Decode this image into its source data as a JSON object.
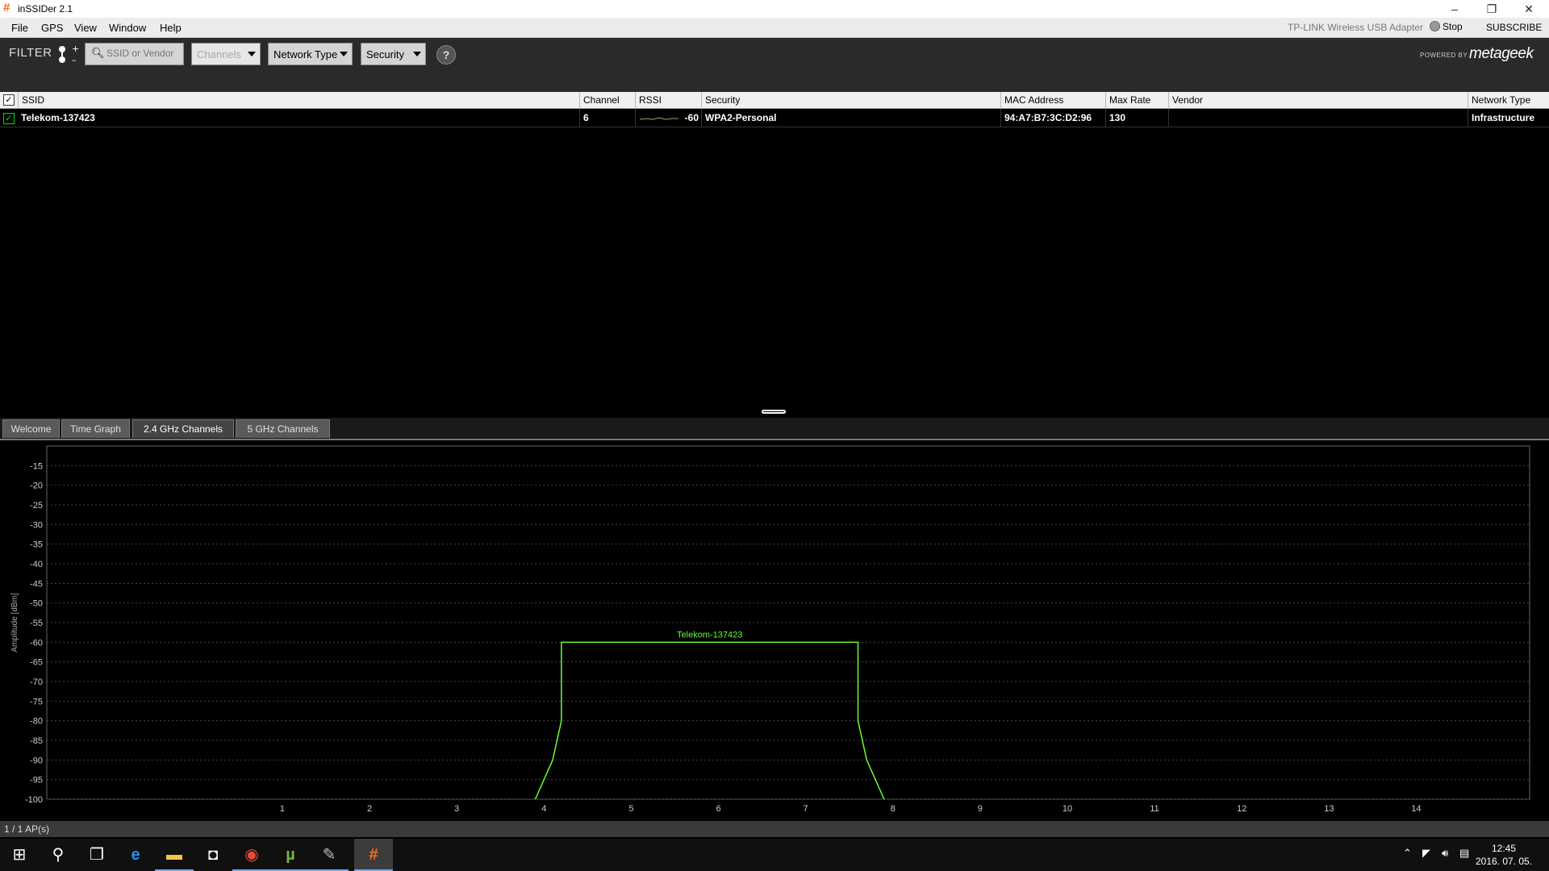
{
  "window": {
    "title": "inSSIDer 2.1",
    "icon": "hash-icon",
    "minimize": "–",
    "restore": "❐",
    "close": "✕"
  },
  "menu": {
    "items": [
      "File",
      "GPS",
      "View",
      "Window",
      "Help"
    ],
    "adapter": "TP-LINK Wireless USB Adapter",
    "stop_label": "Stop",
    "subscribe_label": "SUBSCRIBE"
  },
  "filter": {
    "label": "FILTER",
    "search_placeholder": "SSID or Vendor",
    "channels_label": "Channels",
    "network_type_label": "Network Type",
    "security_label": "Security",
    "help_label": "?",
    "powered_by": "POWERED BY",
    "brand": "metageek"
  },
  "table": {
    "columns": [
      "SSID",
      "Channel",
      "RSSI",
      "Security",
      "MAC Address",
      "Max Rate",
      "Vendor",
      "Network Type"
    ],
    "rows": [
      {
        "checked": true,
        "ssid": "Telekom-137423",
        "channel": "6",
        "rssi": "-60",
        "security": "WPA2-Personal",
        "mac": "94:A7:B7:3C:D2:96",
        "max_rate": "130",
        "vendor": "",
        "network_type": "Infrastructure"
      }
    ]
  },
  "tabs": [
    {
      "label": "Welcome",
      "active": false
    },
    {
      "label": "Time Graph",
      "active": false
    },
    {
      "label": "2.4 GHz Channels",
      "active": true
    },
    {
      "label": "5 GHz Channels",
      "active": false
    }
  ],
  "chart_data": {
    "type": "line",
    "title": "",
    "xlabel": "",
    "ylabel": "Amplitude [dBm]",
    "x_ticks": [
      1,
      2,
      3,
      4,
      5,
      6,
      7,
      8,
      9,
      10,
      11,
      12,
      13,
      14
    ],
    "xlim": [
      -1.7,
      15.3
    ],
    "y_ticks": [
      -15,
      -20,
      -25,
      -30,
      -35,
      -40,
      -45,
      -50,
      -55,
      -60,
      -65,
      -70,
      -75,
      -80,
      -85,
      -90,
      -95,
      -100
    ],
    "ylim": [
      -100,
      -10
    ],
    "grid": true,
    "series": [
      {
        "name": "Telekom-137423",
        "color": "#66ff33",
        "x": [
          3.9,
          4.1,
          4.2,
          4.2,
          7.6,
          7.6,
          7.7,
          7.9
        ],
        "y": [
          -100,
          -90,
          -80,
          -60,
          -60,
          -80,
          -90,
          -100
        ]
      }
    ]
  },
  "status": {
    "ap_count": "1 / 1 AP(s)"
  },
  "taskbar": {
    "apps": [
      {
        "name": "start-icon",
        "glyph": "⊞"
      },
      {
        "name": "search-icon",
        "glyph": "⚲"
      },
      {
        "name": "task-view-icon",
        "glyph": "❐"
      },
      {
        "name": "edge-icon",
        "glyph": "e"
      },
      {
        "name": "file-explorer-icon",
        "glyph": "▬"
      },
      {
        "name": "store-icon",
        "glyph": "◘"
      },
      {
        "name": "chrome-icon",
        "glyph": "◉"
      },
      {
        "name": "utorrent-icon",
        "glyph": "µ"
      },
      {
        "name": "app-icon",
        "glyph": "✎"
      },
      {
        "name": "inssider-icon",
        "glyph": "#"
      }
    ],
    "time": "12:45",
    "date": "2016. 07. 05."
  }
}
